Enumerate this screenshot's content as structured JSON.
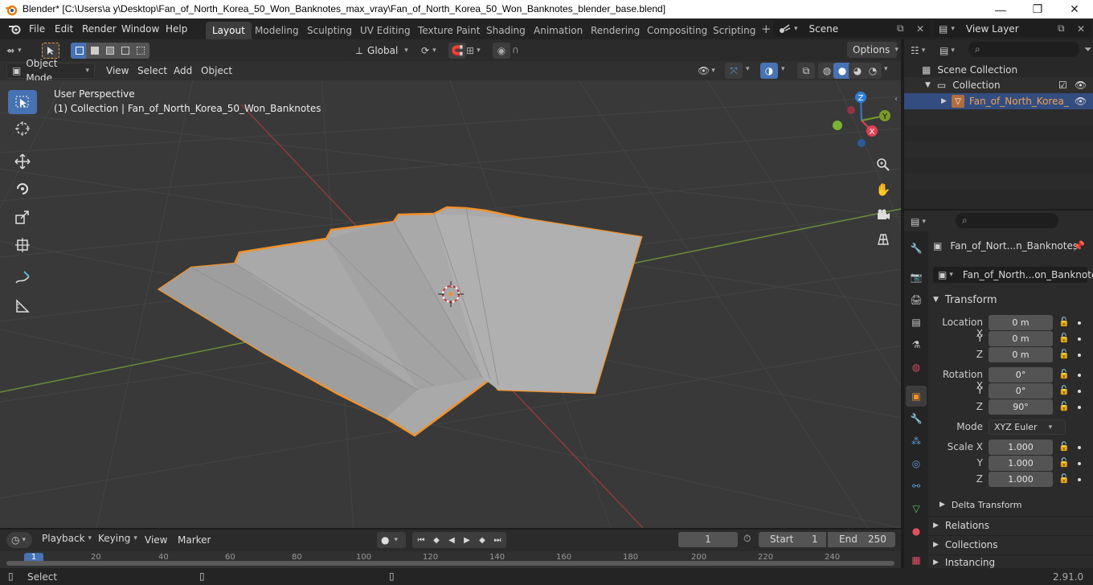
{
  "window": {
    "title": "Blender* [C:\\Users\\a y\\Desktop\\Fan_of_North_Korea_50_Won_Banknotes_max_vray\\Fan_of_North_Korea_50_Won_Banknotes_blender_base.blend]",
    "minimize": "—",
    "maximize": "❐",
    "close": "✕"
  },
  "menu": [
    "File",
    "Edit",
    "Render",
    "Window",
    "Help"
  ],
  "workspaces": [
    "Layout",
    "Modeling",
    "Sculpting",
    "UV Editing",
    "Texture Paint",
    "Shading",
    "Animation",
    "Rendering",
    "Compositing",
    "Scripting"
  ],
  "scene": {
    "name": "Scene",
    "view_layer": "View Layer"
  },
  "toolbar": {
    "orientation": "Global",
    "options": "Options"
  },
  "viewport_header": {
    "mode": "Object Mode",
    "menus": [
      "View",
      "Select",
      "Add",
      "Object"
    ]
  },
  "viewport": {
    "perspective": "User Perspective",
    "collection_info": "(1) Collection | Fan_of_North_Korea_50_Won_Banknotes",
    "gizmo": {
      "x": "X",
      "y": "Y",
      "z": "Z"
    }
  },
  "outliner": {
    "scene_collection": "Scene Collection",
    "collection": "Collection",
    "object": "Fan_of_North_Korea_"
  },
  "properties": {
    "object_name": "Fan_of_Nort...n_Banknotes",
    "data_name": "Fan_of_North...on_Banknotes",
    "transform_title": "Transform",
    "location_label": "Location X",
    "rotation_label": "Rotation X",
    "scale_label": "Scale X",
    "y_label": "Y",
    "z_label": "Z",
    "location": [
      "0 m",
      "0 m",
      "0 m"
    ],
    "rotation": [
      "0°",
      "0°",
      "90°"
    ],
    "mode_label": "Mode",
    "mode": "XYZ Euler",
    "scale": [
      "1.000",
      "1.000",
      "1.000"
    ],
    "delta_transform": "Delta Transform",
    "sections": [
      "Relations",
      "Collections",
      "Instancing"
    ]
  },
  "timeline": {
    "menus": [
      "Playback",
      "Keying",
      "View",
      "Marker"
    ],
    "current_frame": "1",
    "start_label": "Start",
    "start": "1",
    "end_label": "End",
    "end": "250",
    "ruler": [
      "1",
      "20",
      "40",
      "60",
      "80",
      "100",
      "120",
      "140",
      "160",
      "180",
      "200",
      "220",
      "240"
    ]
  },
  "status": {
    "left": "Select",
    "version": "2.91.0"
  },
  "colors": {
    "accent": "#4772b3",
    "selection": "#f2922c",
    "viewport_bg": "#393939"
  }
}
